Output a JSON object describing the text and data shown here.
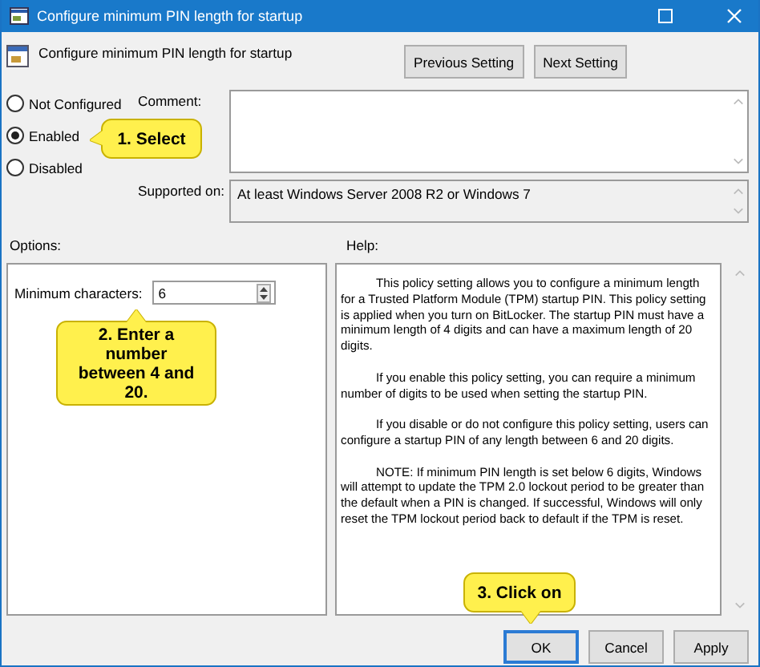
{
  "window": {
    "title": "Configure minimum PIN length for startup"
  },
  "header": {
    "title": "Configure minimum PIN length for startup"
  },
  "nav_buttons": [
    {
      "label": "Previous Setting"
    },
    {
      "label": "Next Setting"
    }
  ],
  "state_options": [
    {
      "label": "Not Configured",
      "selected": false
    },
    {
      "label": "Enabled",
      "selected": true
    },
    {
      "label": "Disabled",
      "selected": false
    }
  ],
  "comment": {
    "label": "Comment:"
  },
  "supported_on": {
    "label": "Supported on:",
    "value": "At least Windows Server 2008 R2 or Windows 7"
  },
  "options": {
    "label": "Options:",
    "fields": [
      {
        "label": "Minimum characters:",
        "value": "6"
      }
    ]
  },
  "help": {
    "label": "Help:",
    "paragraphs": [
      "This policy setting allows you to configure a minimum length for a Trusted Platform Module (TPM) startup PIN. This policy setting is applied when you turn on BitLocker. The startup PIN must have a minimum length of 4 digits and can have a maximum length of 20 digits.",
      "If you enable this policy setting, you can require a minimum number of digits to be used when setting the startup PIN.",
      "If you disable or do not configure this policy setting, users can configure a startup PIN of any length between 6 and 20 digits.",
      "NOTE: If minimum PIN length is set below 6 digits, Windows will attempt to update the TPM 2.0 lockout period to be greater than the default when a PIN is changed. If successful, Windows will only reset the TPM lockout period back to default if the TPM is reset."
    ]
  },
  "callouts": [
    {
      "text": "1. Select",
      "kind": "left"
    },
    {
      "text": "2. Enter a number between 4 and 20.",
      "kind": "up"
    },
    {
      "text": "3. Click on",
      "kind": "down"
    }
  ],
  "buttons": [
    {
      "label": "OK",
      "focused": true
    },
    {
      "label": "Cancel",
      "focused": false
    },
    {
      "label": "Apply",
      "focused": false
    }
  ]
}
